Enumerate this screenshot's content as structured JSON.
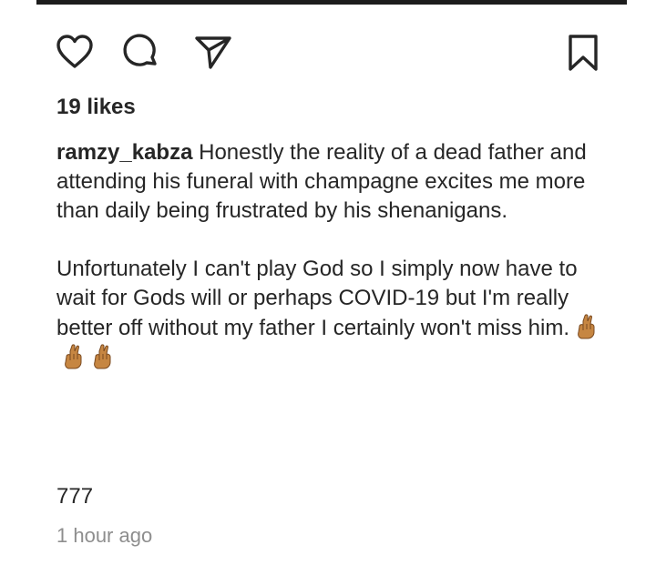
{
  "post": {
    "actions": {
      "like_icon": "heart-icon",
      "comment_icon": "comment-bubble-icon",
      "share_icon": "paper-plane-icon",
      "save_icon": "bookmark-icon"
    },
    "likes_text": "19 likes",
    "caption": {
      "username": "ramzy_kabza",
      "paragraph_1": "Honestly the reality of a dead father and attending his funeral with champagne excites me more than daily being frustrated by his shenanigans.",
      "paragraph_2": "Unfortunately I can't play God so I simply now have to wait for Gods will or perhaps COVID-19 but I'm really better off without my father I certainly won't miss him.",
      "emojis": [
        "crossed-fingers-emoji",
        "crossed-fingers-emoji",
        "crossed-fingers-emoji"
      ]
    },
    "comment_count": "777",
    "timestamp": "1 hour ago"
  },
  "colors": {
    "text": "#262626",
    "muted": "#8e8e8e",
    "icon_stroke": "#262626",
    "emoji_skin": "#c68642"
  }
}
